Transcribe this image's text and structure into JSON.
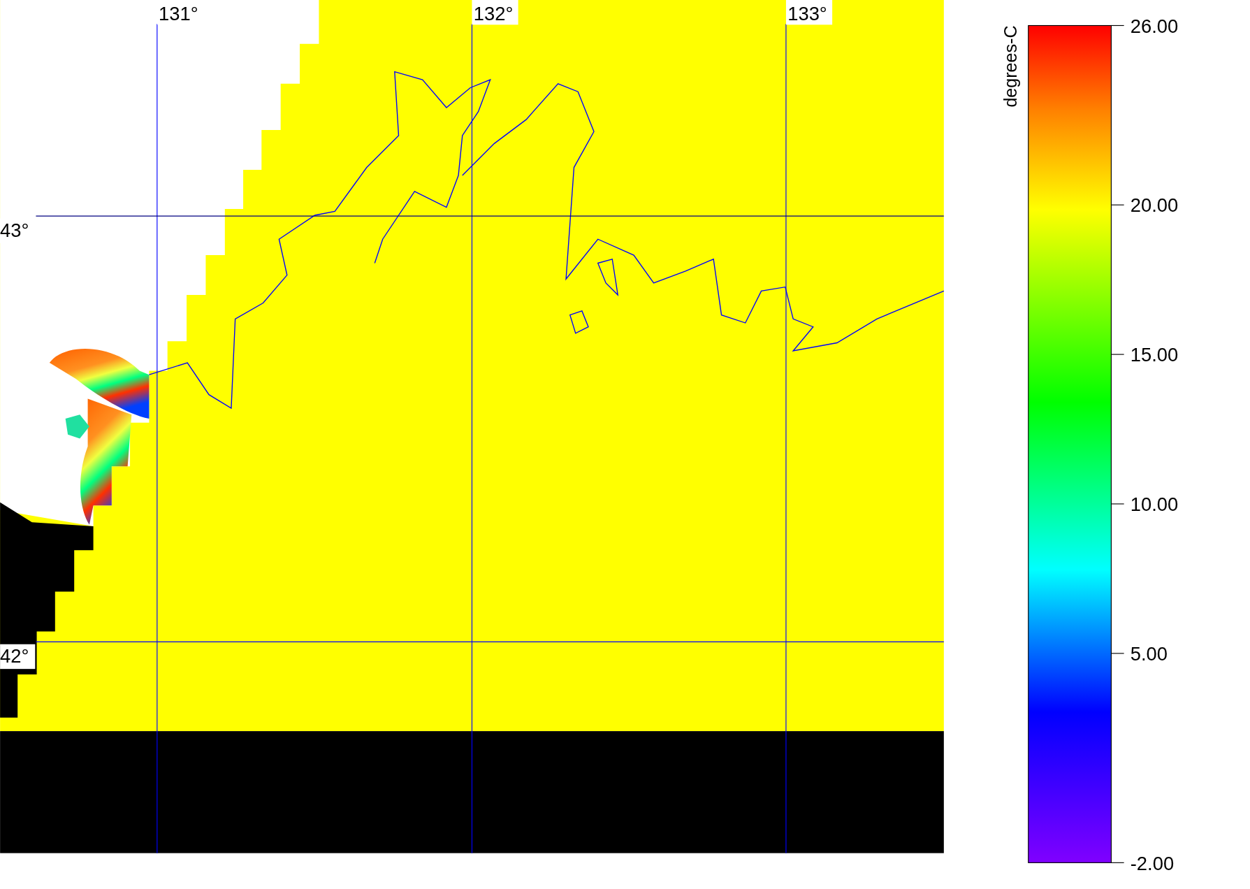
{
  "map": {
    "longitude_labels": [
      "131°",
      "132°",
      "133°"
    ],
    "latitude_labels": [
      "43°",
      "42°"
    ]
  },
  "colorbar": {
    "title": "degrees-C",
    "ticks": [
      "26.00",
      "20.00",
      "15.00",
      "10.00",
      "5.00",
      "-2.00"
    ]
  }
}
